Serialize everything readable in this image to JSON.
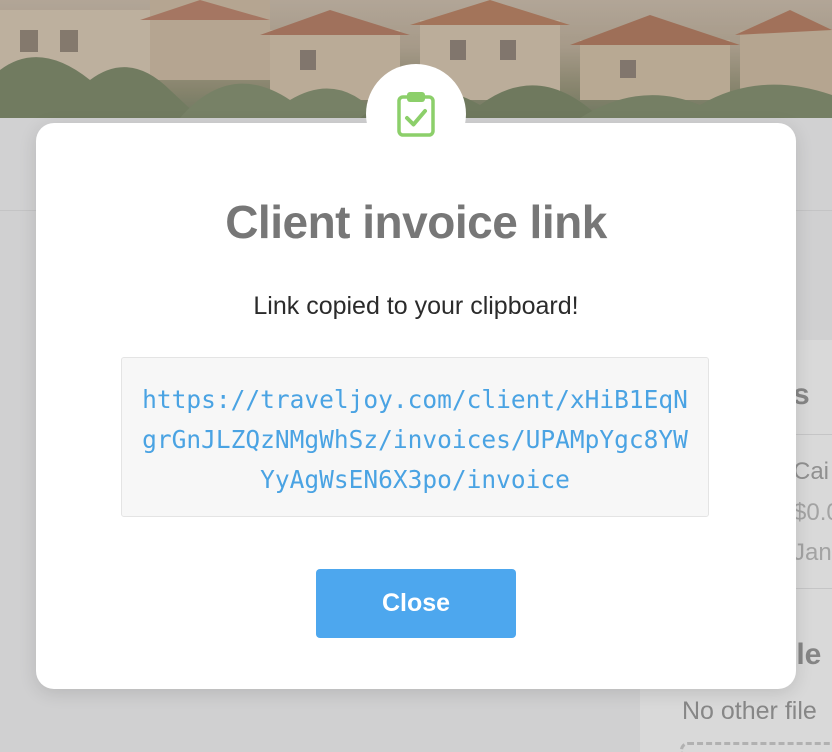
{
  "background": {
    "section_heading_partial": "s",
    "item_title_partial": "Cai",
    "item_amount_partial": "$0.0",
    "item_date_partial": "Jan",
    "files_heading_partial": "ile",
    "files_empty_text": "No other file"
  },
  "modal": {
    "icon": "clipboard-check-icon",
    "title": "Client invoice link",
    "message": "Link copied to your clipboard!",
    "link_url": "https://traveljoy.com/client/xHiB1EqNgrGnJLZQzNMgWhSz/invoices/UPAMpYgc8YWYyAgWsEN6X3po/invoice",
    "close_label": "Close"
  },
  "colors": {
    "accent_button": "#4da7ee",
    "link_text": "#4aa3e3",
    "icon_green": "#8ccf6a",
    "title_gray": "#777777"
  }
}
